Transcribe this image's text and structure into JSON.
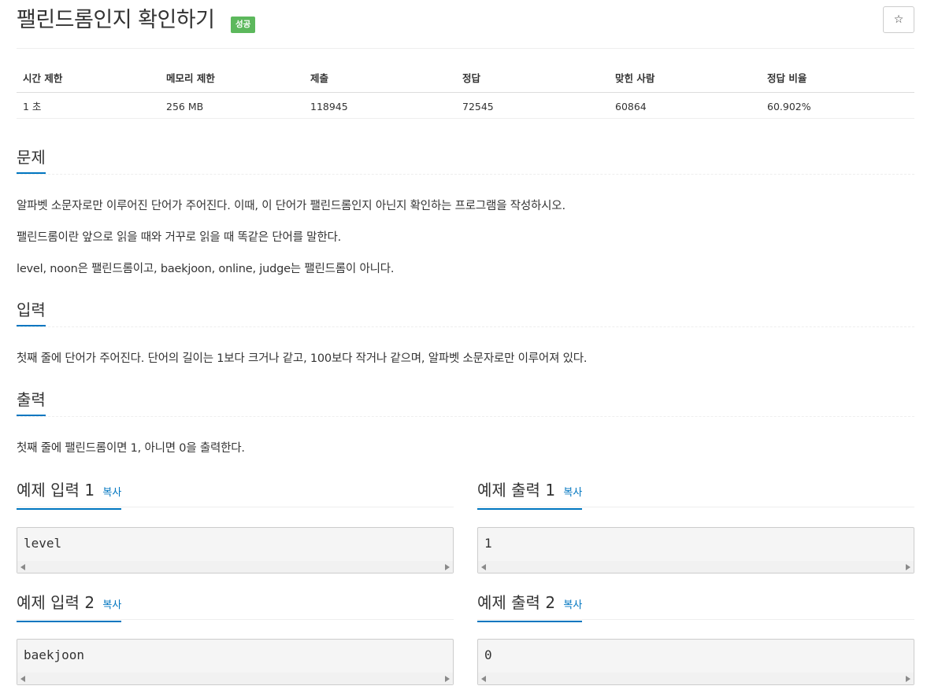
{
  "header": {
    "title": "팰린드롬인지 확인하기",
    "badge": "성공",
    "star": "☆"
  },
  "info_table": {
    "headers": [
      "시간 제한",
      "메모리 제한",
      "제출",
      "정답",
      "맞힌 사람",
      "정답 비율"
    ],
    "values": [
      "1 초",
      "256 MB",
      "118945",
      "72545",
      "60864",
      "60.902%"
    ]
  },
  "problem": {
    "heading": "문제",
    "paragraphs": [
      "알파벳 소문자로만 이루어진 단어가 주어진다. 이때, 이 단어가 팰린드롬인지 아닌지 확인하는 프로그램을 작성하시오.",
      "팰린드롬이란 앞으로 읽을 때와 거꾸로 읽을 때 똑같은 단어를 말한다.",
      "level, noon은 팰린드롬이고, baekjoon, online, judge는 팰린드롬이 아니다."
    ]
  },
  "input": {
    "heading": "입력",
    "text": "첫째 줄에 단어가 주어진다. 단어의 길이는 1보다 크거나 같고, 100보다 작거나 같으며, 알파벳 소문자로만 이루어져 있다."
  },
  "output": {
    "heading": "출력",
    "text": "첫째 줄에 팰린드롬이면 1, 아니면 0을 출력한다."
  },
  "samples": [
    {
      "input_title": "예제 입력 1",
      "output_title": "예제 출력 1",
      "copy": "복사",
      "input": "level",
      "output": "1"
    },
    {
      "input_title": "예제 입력 2",
      "output_title": "예제 출력 2",
      "copy": "복사",
      "input": "baekjoon",
      "output": "0"
    }
  ],
  "colors": {
    "accent": "#0076c0",
    "success_badge": "#5cb85c"
  }
}
